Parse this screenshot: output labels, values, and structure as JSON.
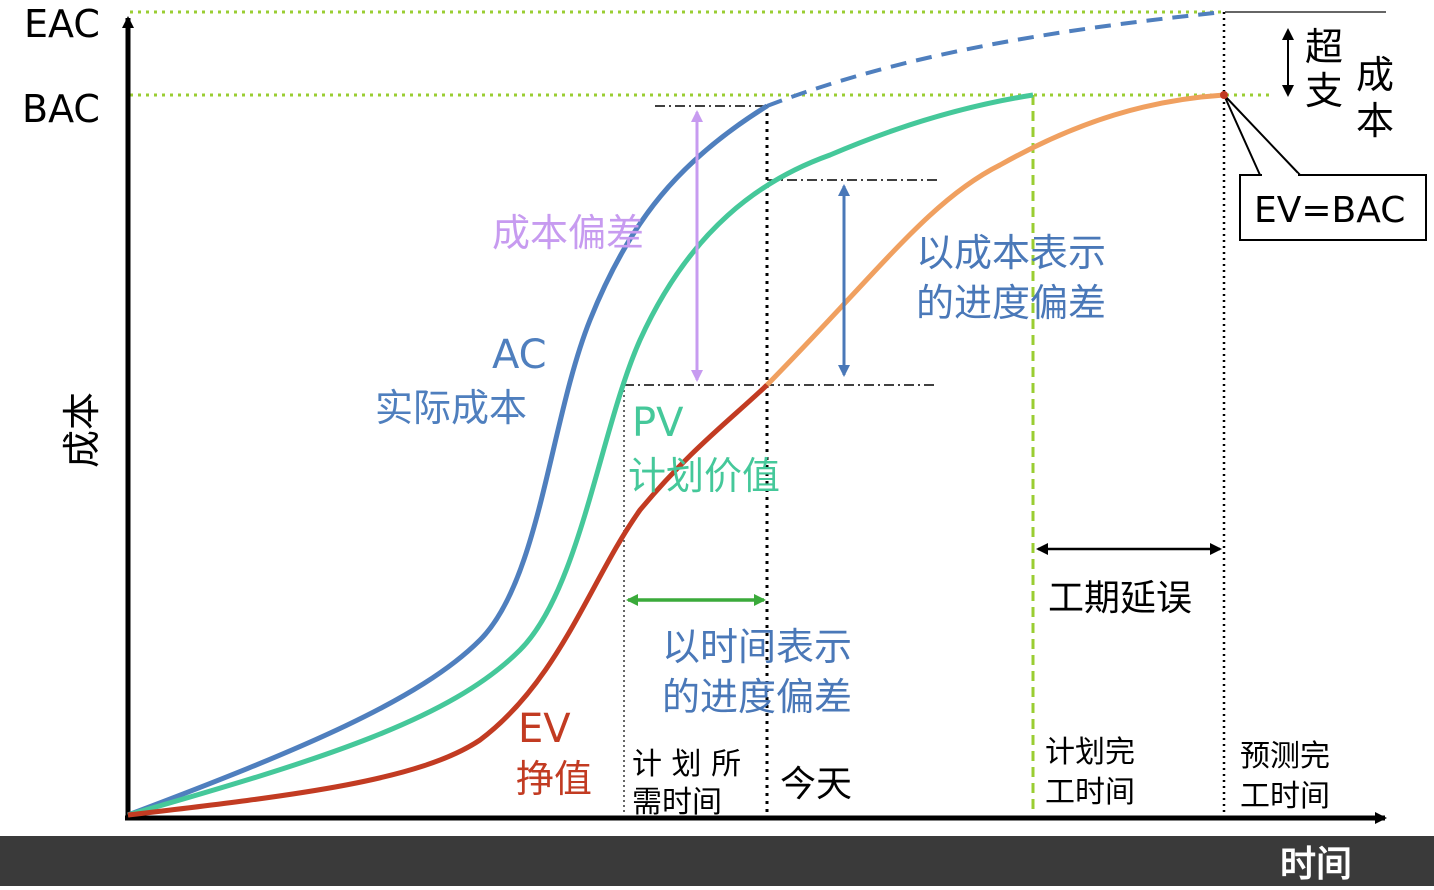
{
  "axes": {
    "y_label": "成本",
    "x_label": "时间",
    "y_ticks": {
      "eac": "EAC",
      "bac": "BAC"
    }
  },
  "curves": {
    "ac": {
      "line1": "AC",
      "line2": "实际成本",
      "color": "#4f7fbe"
    },
    "pv": {
      "line1": "PV",
      "line2": "计划价值",
      "color": "#45c89a"
    },
    "ev": {
      "line1": "EV",
      "line2": "挣值",
      "color": "#c23b22"
    },
    "ev_forecast_color": "#f0a060",
    "ac_forecast_color": "#4f7fbe"
  },
  "annotations": {
    "cost_variance": "成本偏差",
    "schedule_variance_cost": {
      "line1": "以成本表示",
      "line2": "的进度偏差"
    },
    "schedule_variance_time": {
      "line1": "以时间表示",
      "line2": "的进度偏差"
    },
    "overrun": {
      "col1": "超支",
      "col2": "成本"
    },
    "ev_equals_bac": "EV=BAC",
    "schedule_delay": "工期延误"
  },
  "time_marks": {
    "planned_needed": {
      "line1": "计 划 所",
      "line2": "需时间"
    },
    "today": "今天",
    "planned_finish": {
      "line1": "计划完",
      "line2": "工时间"
    },
    "forecast_finish": {
      "line1": "预测完",
      "line2": "工时间"
    }
  },
  "colors": {
    "cost_variance": "#c79bf0",
    "schedule_cost": "#4a78b8",
    "schedule_time": "#3aaa3a",
    "guide_green": "#9acd32",
    "bottom_bar": "#3a3a3a"
  }
}
